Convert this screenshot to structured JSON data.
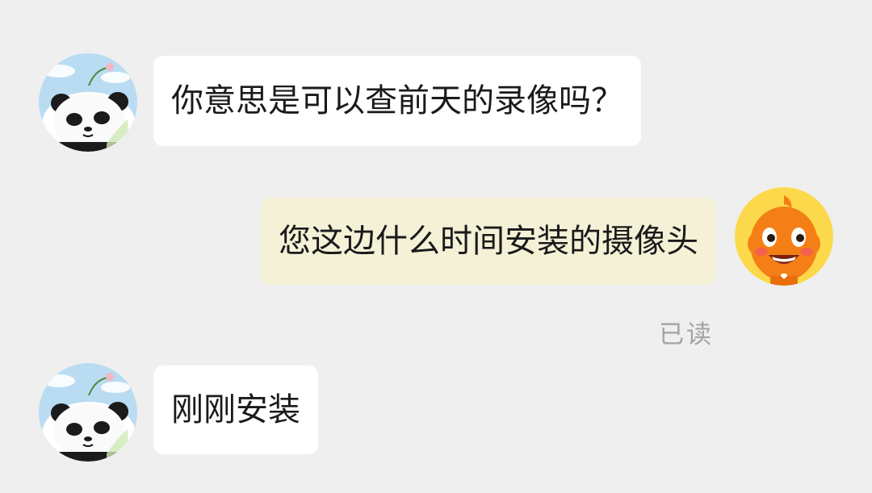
{
  "messages": [
    {
      "direction": "incoming",
      "avatar": "panda-avatar",
      "text": "你意思是可以查前天的录像吗？"
    },
    {
      "direction": "outgoing",
      "avatar": "orange-mascot-avatar",
      "text": "您这边什么时间安装的摄像头",
      "status": "已读"
    },
    {
      "direction": "incoming",
      "avatar": "panda-avatar",
      "text": "刚刚安装"
    }
  ],
  "colors": {
    "background": "#efefef",
    "incoming_bubble": "#ffffff",
    "outgoing_bubble": "#f4f1d7",
    "text": "#1a1a1a",
    "read_status": "#a3a3a3",
    "mascot_orange": "#f47f16"
  }
}
